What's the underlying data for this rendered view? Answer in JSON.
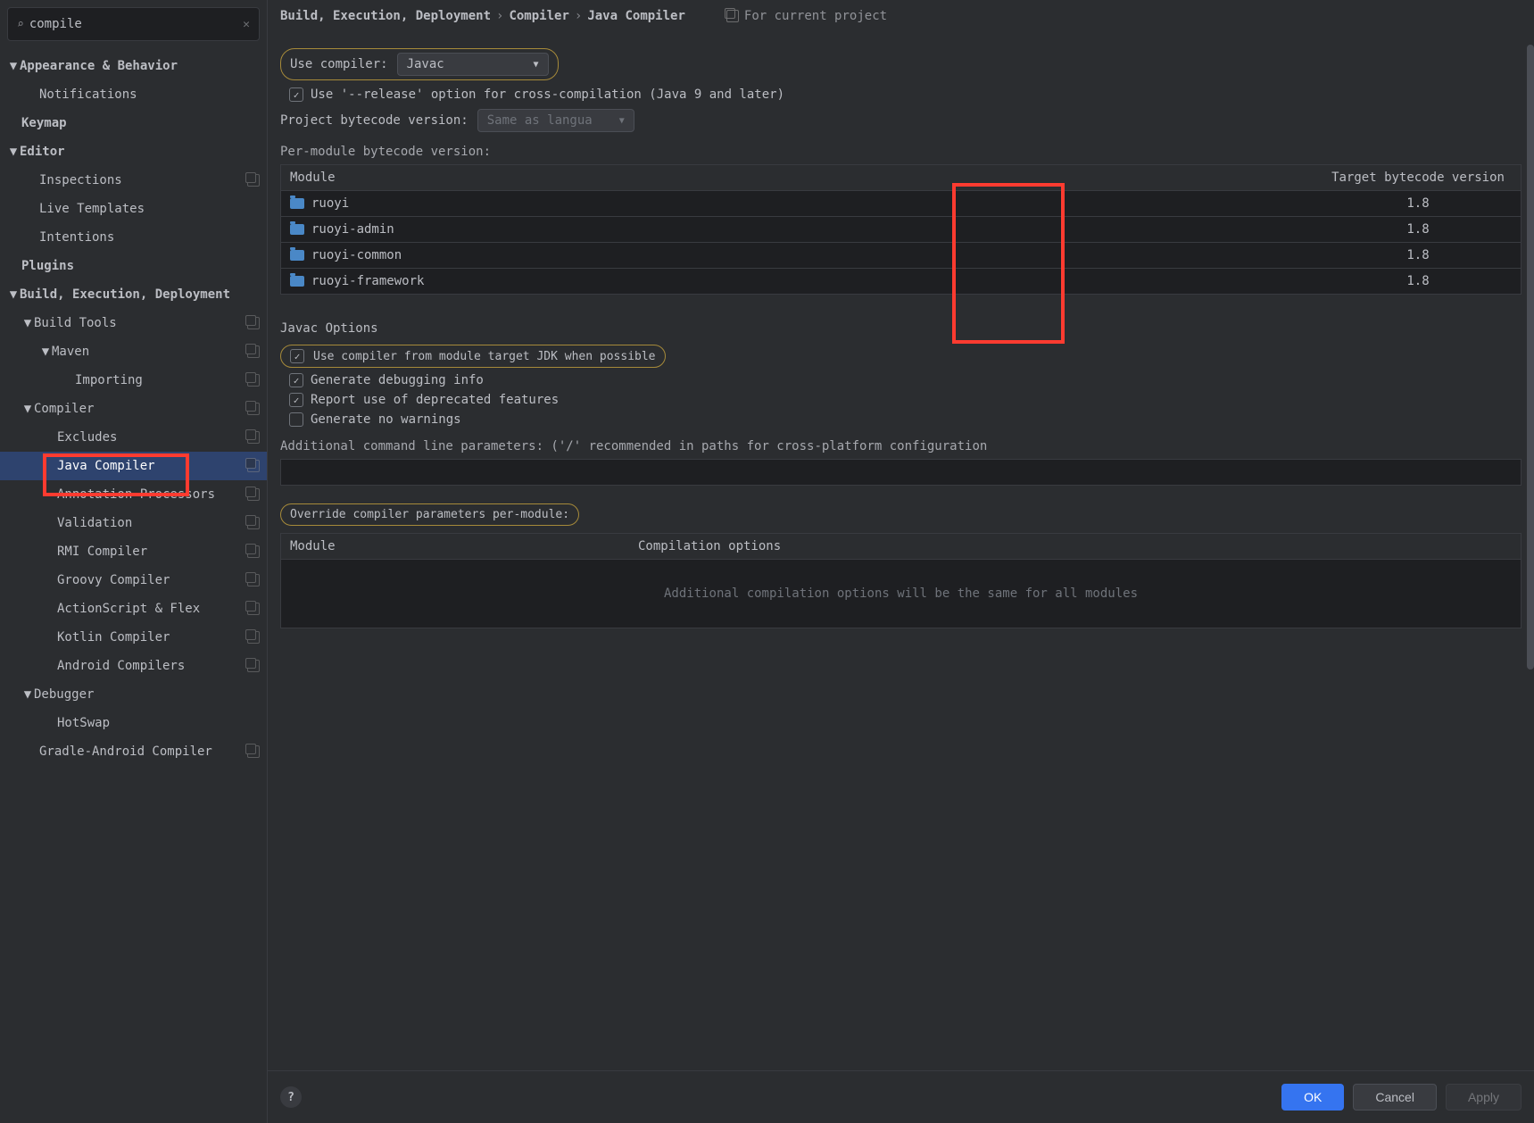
{
  "search": {
    "value": "compile"
  },
  "sidebar": {
    "items": [
      {
        "label": "Appearance & Behavior",
        "arrow": "▼",
        "bold": true,
        "indent": 0
      },
      {
        "label": "Notifications",
        "indent": 2
      },
      {
        "label": "Keymap",
        "bold": true,
        "indent": 1
      },
      {
        "label": "Editor",
        "arrow": "▼",
        "bold": true,
        "indent": 0
      },
      {
        "label": "Inspections",
        "indent": 2,
        "badge": true
      },
      {
        "label": "Live Templates",
        "indent": 2
      },
      {
        "label": "Intentions",
        "indent": 2
      },
      {
        "label": "Plugins",
        "bold": true,
        "indent": 1
      },
      {
        "label": "Build, Execution, Deployment",
        "arrow": "▼",
        "bold": true,
        "indent": 0
      },
      {
        "label": "Build Tools",
        "arrow": "▼",
        "indent": 1,
        "badge": true
      },
      {
        "label": "Maven",
        "arrow": "▼",
        "indent": 2,
        "badge": true
      },
      {
        "label": "Importing",
        "indent": 4,
        "badge": true
      },
      {
        "label": "Compiler",
        "arrow": "▼",
        "indent": 1,
        "badge": true
      },
      {
        "label": "Excludes",
        "indent": 3,
        "badge": true
      },
      {
        "label": "Java Compiler",
        "indent": 3,
        "badge": true,
        "selected": true
      },
      {
        "label": "Annotation Processors",
        "indent": 3,
        "badge": true
      },
      {
        "label": "Validation",
        "indent": 3,
        "badge": true
      },
      {
        "label": "RMI Compiler",
        "indent": 3,
        "badge": true
      },
      {
        "label": "Groovy Compiler",
        "indent": 3,
        "badge": true
      },
      {
        "label": "ActionScript & Flex",
        "indent": 3,
        "badge": true
      },
      {
        "label": "Kotlin Compiler",
        "indent": 3,
        "badge": true
      },
      {
        "label": "Android Compilers",
        "indent": 3,
        "badge": true
      },
      {
        "label": "Debugger",
        "arrow": "▼",
        "indent": 1
      },
      {
        "label": "HotSwap",
        "indent": 3
      },
      {
        "label": "Gradle-Android Compiler",
        "indent": 2,
        "badge": true
      }
    ]
  },
  "breadcrumb": {
    "a": "Build, Execution, Deployment",
    "b": "Compiler",
    "c": "Java Compiler",
    "scope": "For current project"
  },
  "main": {
    "use_compiler_label": "Use compiler:",
    "compiler_value": "Javac",
    "release_option": "Use '--release' option for cross-compilation (Java 9 and later)",
    "project_bytecode_label": "Project bytecode version:",
    "project_bytecode_placeholder": "Same as langua",
    "per_module_label": "Per-module bytecode version:",
    "table": {
      "col1": "Module",
      "col2": "Target bytecode version",
      "rows": [
        {
          "module": "ruoyi",
          "version": "1.8"
        },
        {
          "module": "ruoyi-admin",
          "version": "1.8"
        },
        {
          "module": "ruoyi-common",
          "version": "1.8"
        },
        {
          "module": "ruoyi-framework",
          "version": "1.8"
        }
      ]
    },
    "javac_heading": "Javac Options",
    "opt_use_target_jdk": "Use compiler from module target JDK when possible",
    "opt_debug": "Generate debugging info",
    "opt_deprecated": "Report use of deprecated features",
    "opt_no_warnings": "Generate no warnings",
    "additional_params_label": "Additional command line parameters:  ('/' recommended in paths for cross-platform configuration",
    "override_label": "Override compiler parameters per-module:",
    "override_table": {
      "col1": "Module",
      "col2": "Compilation options",
      "empty": "Additional compilation options will be the same for all modules"
    }
  },
  "footer": {
    "ok": "OK",
    "cancel": "Cancel",
    "apply": "Apply"
  }
}
